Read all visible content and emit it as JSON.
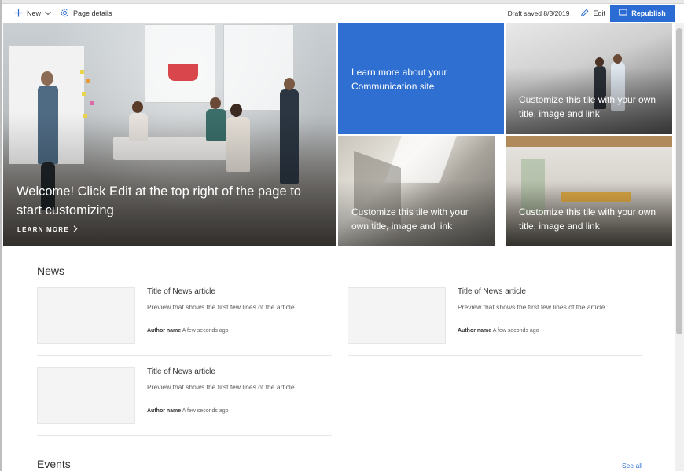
{
  "command_bar": {
    "new_label": "New",
    "page_details_label": "Page details",
    "draft_status": "Draft saved 8/3/2019",
    "edit_label": "Edit",
    "republish_label": "Republish"
  },
  "colors": {
    "accent": "#2b6cd4",
    "tile_blue": "#2e6fd1",
    "text_primary": "#323130",
    "text_secondary": "#605e5c"
  },
  "hero": {
    "main_title": "Welcome! Click Edit at the top right of the page to start customizing",
    "learn_more_label": "LEARN MORE",
    "tiles": [
      {
        "text": "Learn more about your Communication site"
      },
      {
        "text": "Customize this tile with your own title, image and link"
      },
      {
        "text": "Customize this tile with your own title, image and link"
      },
      {
        "text": "Customize this tile with your own title, image and link"
      }
    ]
  },
  "news": {
    "title": "News",
    "items": [
      {
        "title": "Title of News article",
        "preview": "Preview that shows the first few lines of the article.",
        "author": "Author name",
        "time": "A few seconds ago"
      },
      {
        "title": "Title of News article",
        "preview": "Preview that shows the first few lines of the article.",
        "author": "Author name",
        "time": "A few seconds ago"
      },
      {
        "title": "Title of News article",
        "preview": "Preview that shows the first few lines of the article.",
        "author": "Author name",
        "time": "A few seconds ago"
      }
    ]
  },
  "events": {
    "title": "Events",
    "see_all_label": "See all"
  }
}
